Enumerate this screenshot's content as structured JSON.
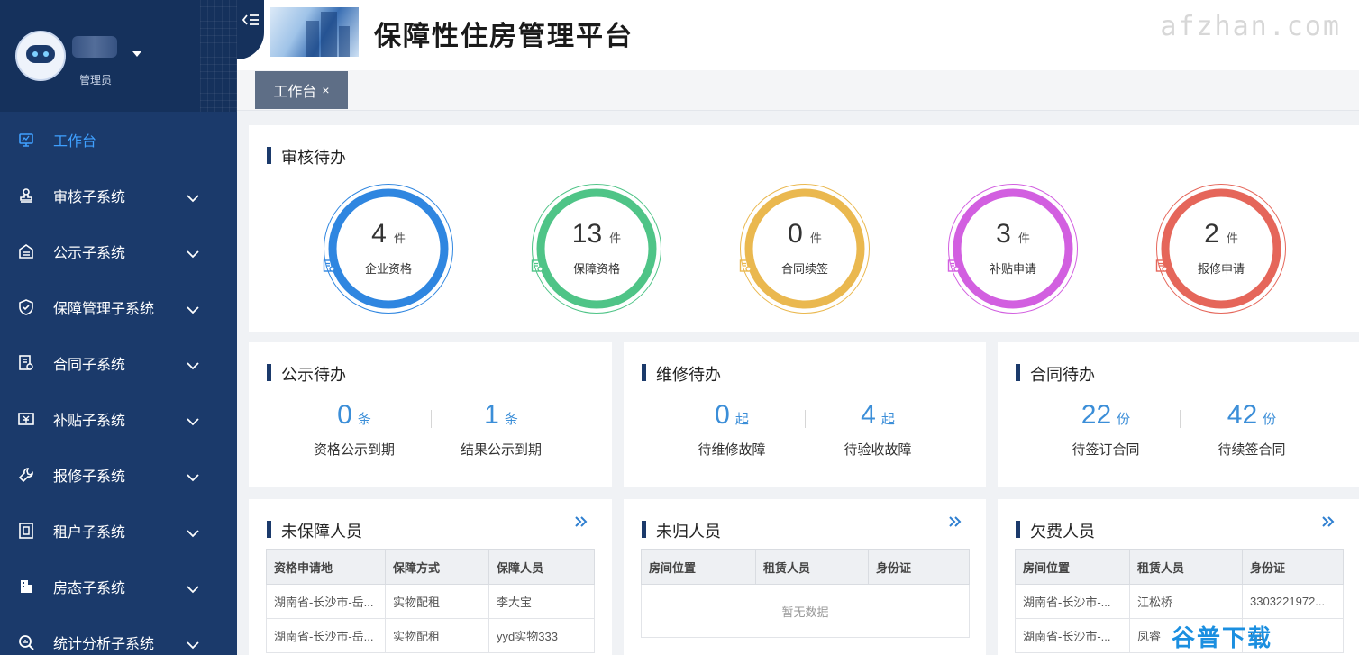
{
  "user": {
    "role": "管理员"
  },
  "menu": [
    {
      "label": "工作台",
      "icon": "monitor-icon",
      "active": true
    },
    {
      "label": "审核子系统",
      "icon": "stamp-icon"
    },
    {
      "label": "公示子系统",
      "icon": "board-icon"
    },
    {
      "label": "保障管理子系统",
      "icon": "shield-icon"
    },
    {
      "label": "合同子系统",
      "icon": "contract-icon"
    },
    {
      "label": "补贴子系统",
      "icon": "subsidy-icon"
    },
    {
      "label": "报修子系统",
      "icon": "wrench-icon"
    },
    {
      "label": "租户子系统",
      "icon": "tenant-icon"
    },
    {
      "label": "房态子系统",
      "icon": "building-icon"
    },
    {
      "label": "统计分析子系统",
      "icon": "chart-search-icon"
    }
  ],
  "header": {
    "title": "保障性住房管理平台",
    "watermark": "afzhan.com"
  },
  "tabs": [
    {
      "label": "工作台",
      "close": "×"
    }
  ],
  "audit": {
    "title": "审核待办",
    "items": [
      {
        "value": "4",
        "unit": "件",
        "label": "企业资格",
        "color": "#2f86e0"
      },
      {
        "value": "13",
        "unit": "件",
        "label": "保障资格",
        "color": "#4fc487"
      },
      {
        "value": "0",
        "unit": "件",
        "label": "合同续签",
        "color": "#eab84f"
      },
      {
        "value": "3",
        "unit": "件",
        "label": "补贴申请",
        "color": "#d25fe0"
      },
      {
        "value": "2",
        "unit": "件",
        "label": "报修申请",
        "color": "#e5665a"
      }
    ]
  },
  "publicity": {
    "title": "公示待办",
    "stats": [
      {
        "value": "0",
        "unit": "条",
        "desc": "资格公示到期"
      },
      {
        "value": "1",
        "unit": "条",
        "desc": "结果公示到期"
      }
    ]
  },
  "repair": {
    "title": "维修待办",
    "stats": [
      {
        "value": "0",
        "unit": "起",
        "desc": "待维修故障"
      },
      {
        "value": "4",
        "unit": "起",
        "desc": "待验收故障"
      }
    ]
  },
  "contract": {
    "title": "合同待办",
    "stats": [
      {
        "value": "22",
        "unit": "份",
        "desc": "待签订合同"
      },
      {
        "value": "42",
        "unit": "份",
        "desc": "待续签合同"
      }
    ]
  },
  "unprotected": {
    "title": "未保障人员",
    "columns": [
      "资格申请地",
      "保障方式",
      "保障人员"
    ],
    "rows": [
      [
        "湖南省-长沙市-岳...",
        "实物配租",
        "李大宝"
      ],
      [
        "湖南省-长沙市-岳...",
        "实物配租",
        "yyd实物333"
      ]
    ]
  },
  "unreturned": {
    "title": "未归人员",
    "columns": [
      "房间位置",
      "租赁人员",
      "身份证"
    ],
    "empty": "暂无数据"
  },
  "arrears": {
    "title": "欠费人员",
    "columns": [
      "房间位置",
      "租赁人员",
      "身份证"
    ],
    "rows": [
      [
        "湖南省-长沙市-...",
        "江松桥",
        "3303221972..."
      ],
      [
        "湖南省-长沙市-...",
        "凤睿",
        "51"
      ]
    ]
  },
  "footer_watermark": "谷普下载"
}
